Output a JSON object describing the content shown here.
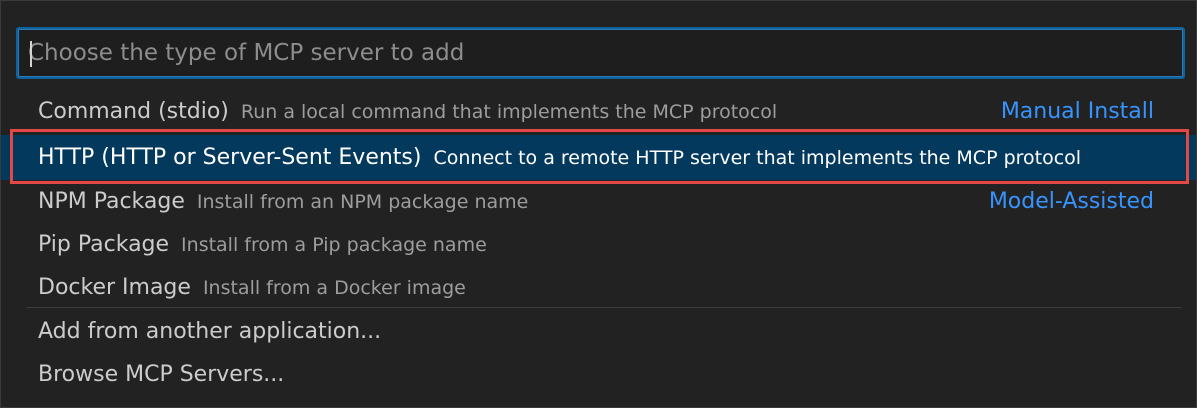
{
  "quick_pick": {
    "placeholder": "Choose the type of MCP server to add",
    "items": [
      {
        "label": "Command (stdio)",
        "description": "Run a local command that implements the MCP protocol",
        "group": "Manual Install"
      },
      {
        "label": "HTTP (HTTP or Server-Sent Events)",
        "description": "Connect to a remote HTTP server that implements the MCP protocol",
        "group": ""
      },
      {
        "label": "NPM Package",
        "description": "Install from an NPM package name",
        "group": "Model-Assisted"
      },
      {
        "label": "Pip Package",
        "description": "Install from a Pip package name",
        "group": ""
      },
      {
        "label": "Docker Image",
        "description": "Install from a Docker image",
        "group": ""
      }
    ],
    "extra_items": [
      {
        "label": "Add from another application..."
      },
      {
        "label": "Browse MCP Servers..."
      }
    ]
  },
  "colors": {
    "background": "#222222",
    "accent": "#3794ff",
    "selected_bg": "#04395e",
    "highlight_border": "#e34848"
  }
}
